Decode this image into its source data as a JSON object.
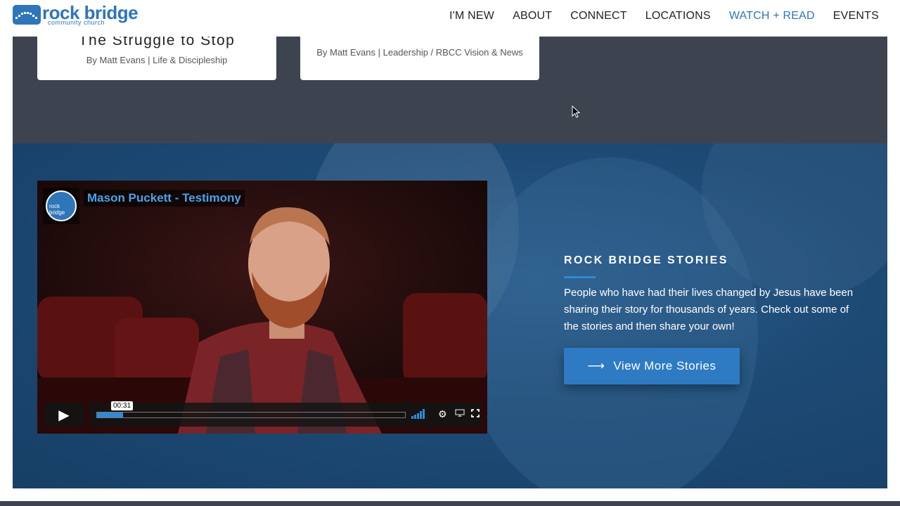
{
  "header": {
    "logo_main": "rock bridge",
    "logo_sub": "community church",
    "nav": [
      "I'M NEW",
      "ABOUT",
      "CONNECT",
      "LOCATIONS",
      "WATCH + READ",
      "EVENTS"
    ],
    "active_nav": "WATCH + READ"
  },
  "blog": {
    "card1": {
      "title": "The Struggle to Stop",
      "meta": "By Matt Evans | Life & Discipleship"
    },
    "card2": {
      "title": "",
      "meta": "By Matt Evans | Leadership / RBCC Vision & News"
    }
  },
  "video": {
    "title": "Mason Puckett - Testimony",
    "channel_label": "rock bridge",
    "time_tooltip": "00:31",
    "progress": 0.085,
    "play_icon": "play-icon",
    "icons": [
      "volume-icon",
      "gear-icon",
      "airplay-icon",
      "fullscreen-icon"
    ]
  },
  "stories": {
    "heading": "ROCK BRIDGE STORIES",
    "body": "People who have had their lives changed by Jesus have been sharing their story for thousands of years. Check out some of the stories and then share your own!",
    "button_label": "View More Stories",
    "button_icon": "arrow-right-icon"
  },
  "colors": {
    "brand_blue": "#2e75b9",
    "dark_strip": "#3d444f",
    "stories_bg": "#1d4a75",
    "button": "#2e7bc4",
    "video_title": "#4aa3e8"
  }
}
